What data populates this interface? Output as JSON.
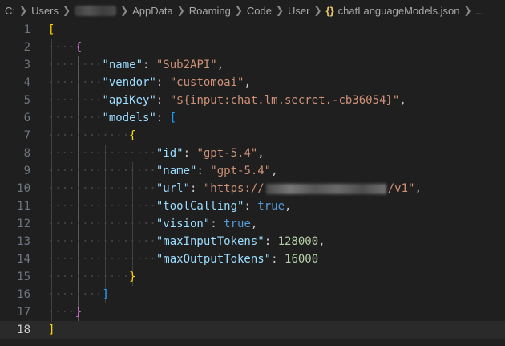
{
  "breadcrumb": {
    "drive": "C:",
    "users": "Users",
    "appdata": "AppData",
    "roaming": "Roaming",
    "code": "Code",
    "user": "User",
    "file_icon": "{}",
    "file": "chatLanguageModels.json",
    "more": "..."
  },
  "gutter": [
    "1",
    "2",
    "3",
    "4",
    "5",
    "6",
    "7",
    "8",
    "9",
    "10",
    "11",
    "12",
    "13",
    "14",
    "15",
    "16",
    "17",
    "18"
  ],
  "json": {
    "name_key": "\"name\"",
    "name_val": "\"Sub2API\"",
    "vendor_key": "\"vendor\"",
    "vendor_val": "\"customoai\"",
    "apikey_key": "\"apiKey\"",
    "apikey_val": "\"${input:chat.lm.secret.-cb36054}\"",
    "models_key": "\"models\"",
    "id_key": "\"id\"",
    "id_val": "\"gpt-5.4\"",
    "mname_key": "\"name\"",
    "mname_val": "\"gpt-5.4\"",
    "url_key": "\"url\"",
    "url_prefix": "\"https://",
    "url_suffix": "/v1\"",
    "tool_key": "\"toolCalling\"",
    "tool_val": "true",
    "vision_key": "\"vision\"",
    "vision_val": "true",
    "maxin_key": "\"maxInputTokens\"",
    "maxin_val": "128000",
    "maxout_key": "\"maxOutputTokens\"",
    "maxout_val": "16000"
  }
}
